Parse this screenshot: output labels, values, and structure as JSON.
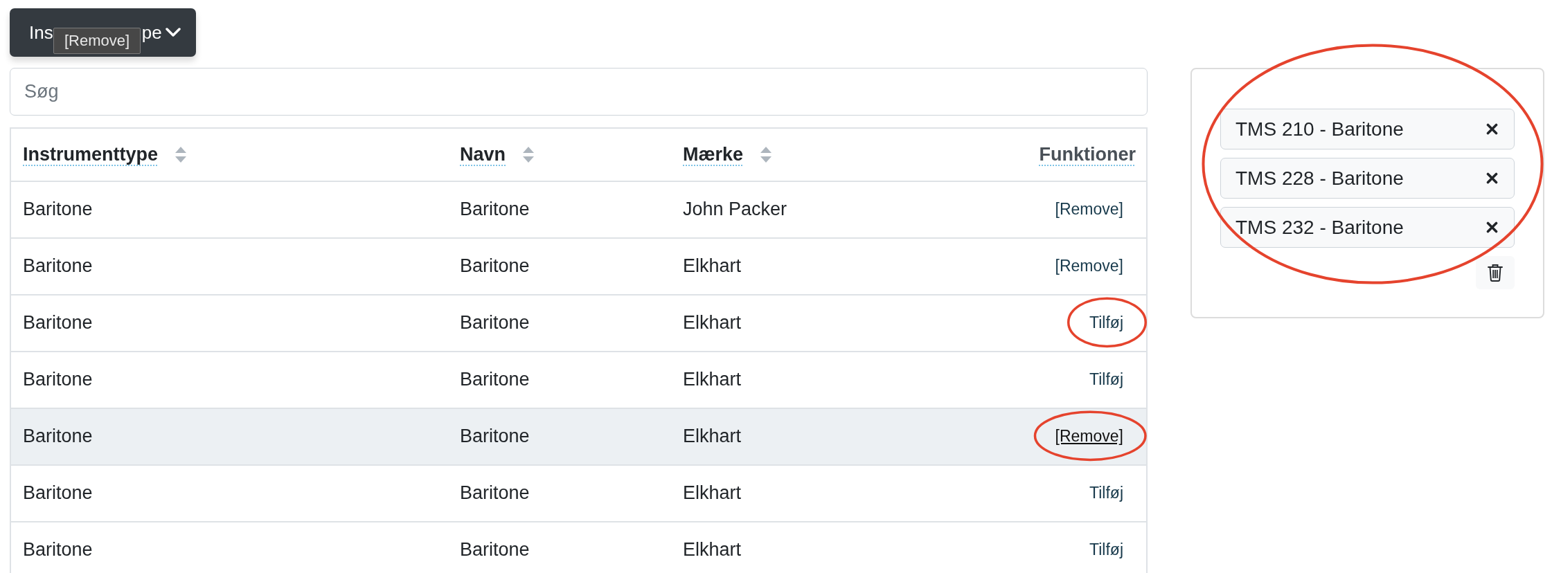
{
  "filter_button": {
    "label_start": "Ins",
    "label_end": "pe"
  },
  "tooltip": {
    "text": "[Remove]"
  },
  "search": {
    "placeholder": "Søg"
  },
  "table": {
    "columns": [
      {
        "label": "Instrumenttype",
        "sortable": true
      },
      {
        "label": "Navn",
        "sortable": true
      },
      {
        "label": "Mærke",
        "sortable": true
      },
      {
        "label": "Funktioner",
        "sortable": false
      }
    ],
    "rows": [
      {
        "cells": [
          "Baritone",
          "Baritone",
          "John Packer"
        ],
        "action": "[Remove]",
        "hovered": false,
        "circled": false
      },
      {
        "cells": [
          "Baritone",
          "Baritone",
          "Elkhart"
        ],
        "action": "[Remove]",
        "hovered": false,
        "circled": false
      },
      {
        "cells": [
          "Baritone",
          "Baritone",
          "Elkhart"
        ],
        "action": "Tilføj",
        "hovered": false,
        "circled": true
      },
      {
        "cells": [
          "Baritone",
          "Baritone",
          "Elkhart"
        ],
        "action": "Tilføj",
        "hovered": false,
        "circled": false
      },
      {
        "cells": [
          "Baritone",
          "Baritone",
          "Elkhart"
        ],
        "action": "[Remove]",
        "hovered": true,
        "circled": true
      },
      {
        "cells": [
          "Baritone",
          "Baritone",
          "Elkhart"
        ],
        "action": "Tilføj",
        "hovered": false,
        "circled": false
      },
      {
        "cells": [
          "Baritone",
          "Baritone",
          "Elkhart"
        ],
        "action": "Tilføj",
        "hovered": false,
        "circled": false
      }
    ]
  },
  "selection_panel": {
    "circled": true,
    "items": [
      {
        "label": "TMS 210 - Baritone"
      },
      {
        "label": "TMS 228 - Baritone"
      },
      {
        "label": "TMS 232 - Baritone"
      }
    ]
  }
}
